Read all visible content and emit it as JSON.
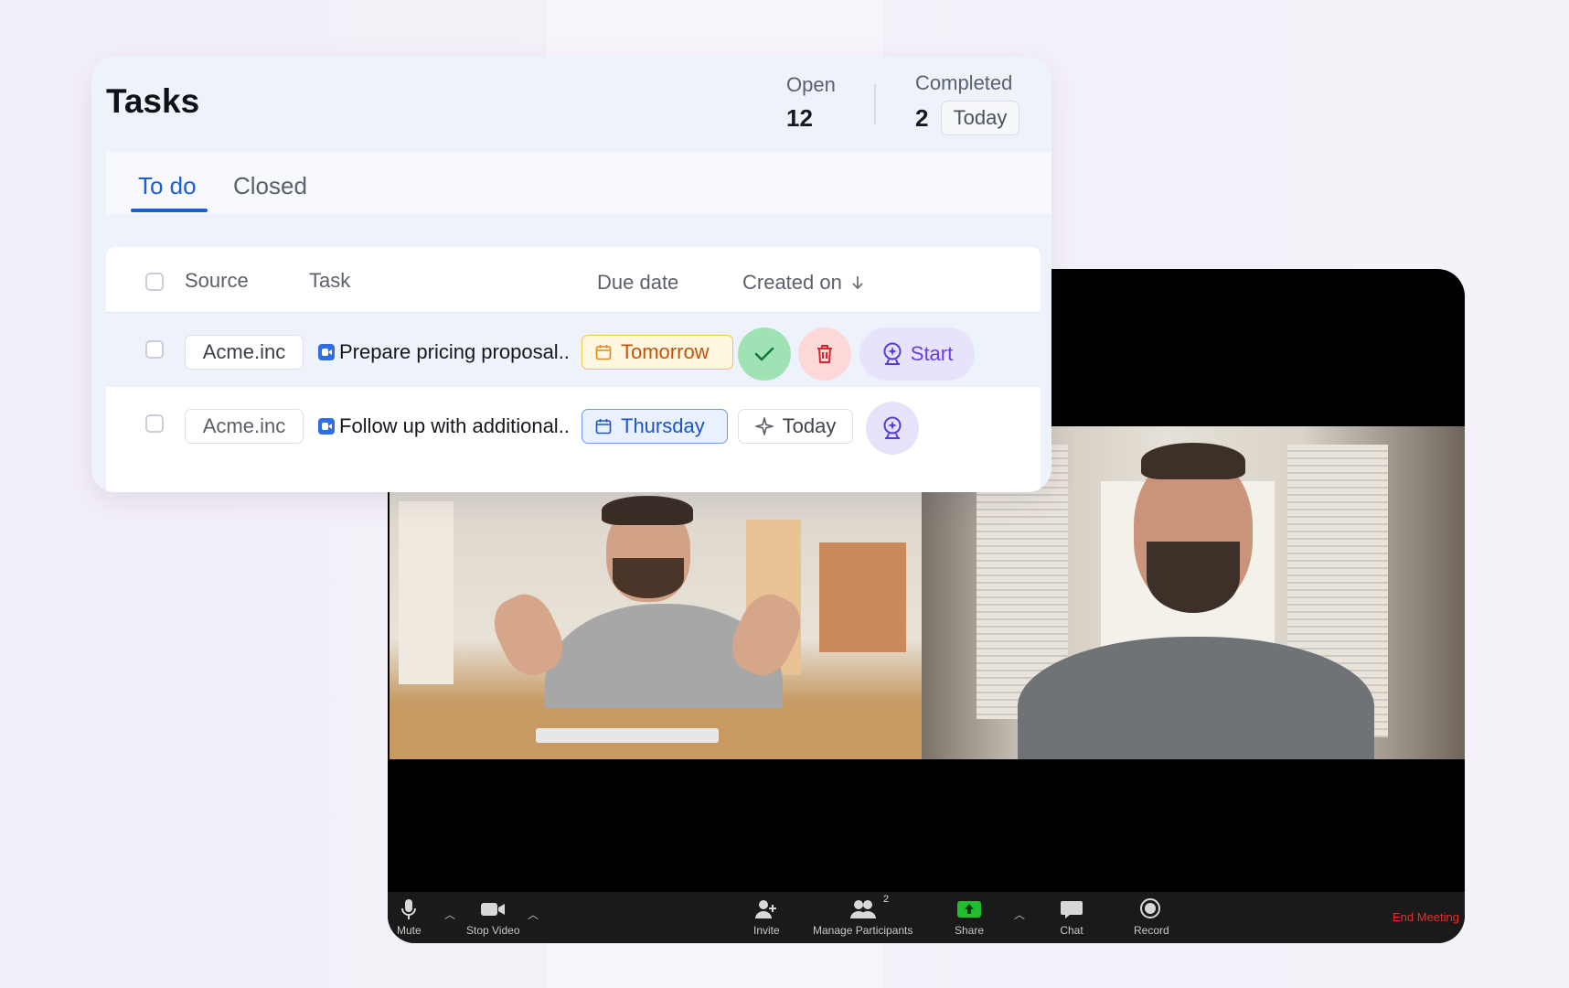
{
  "tasks_card": {
    "title": "Tasks",
    "stats": {
      "open_label": "Open",
      "open_value": "12",
      "completed_label": "Completed",
      "completed_value": "2",
      "completed_period": "Today"
    },
    "tabs": [
      {
        "label": "To do",
        "active": true
      },
      {
        "label": "Closed",
        "active": false
      }
    ],
    "columns": [
      "Source",
      "Task",
      "Due date",
      "Created on"
    ],
    "created_on_sort_icon": "arrow-down-icon",
    "rows": [
      {
        "source": "Acme.inc",
        "task": "Prepare pricing proposal..",
        "due": "Tomorrow",
        "due_color": "#f6c24a",
        "actions": {
          "complete_icon": "check-icon",
          "delete_icon": "trash-icon",
          "start_label": "Start"
        }
      },
      {
        "source": "Acme.inc",
        "task": "Follow up with additional..",
        "due": "Thursday",
        "due_color": "#6b9bf0",
        "created_on": "Today"
      }
    ]
  },
  "meeting": {
    "toolbar": {
      "mute": "Mute",
      "stop_video": "Stop Video",
      "invite": "Invite",
      "manage_participants": "Manage Participants",
      "participant_count": "2",
      "share": "Share",
      "chat": "Chat",
      "record": "Record",
      "end_meeting": "End Meeting"
    },
    "colors": {
      "share_green": "#1fbf2e",
      "end_red": "#e0312b"
    }
  },
  "colors": {
    "accent_blue": "#1a5fd8",
    "start_purple": "#6a3fe0"
  }
}
